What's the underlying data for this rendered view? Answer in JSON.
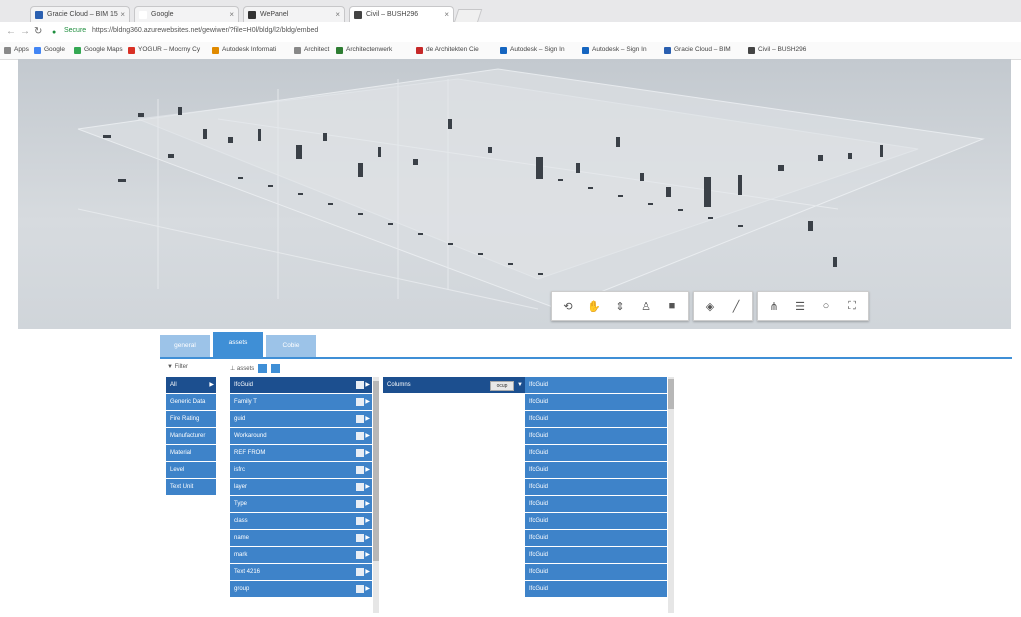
{
  "browser": {
    "tabs": [
      {
        "label": "Gracie Cloud – BIM 15",
        "icon_color": "#2a5fb0",
        "active": false
      },
      {
        "label": "Google",
        "icon_color": "#ffffff",
        "active": false
      },
      {
        "label": "WePanel",
        "icon_color": "#333333",
        "active": false
      },
      {
        "label": "Civil – BUSH296",
        "icon_color": "#444444",
        "active": true
      }
    ],
    "tab_close_glyph": "×",
    "secure_label": "Secure",
    "url": "https://bldng360.azurewebsites.net/gewiwer/?file=H0l/bldg/l2/bldg/embed",
    "bookmarks": [
      {
        "label": "Apps",
        "icon_color": "#888888"
      },
      {
        "label": "Google",
        "icon_color": "#4285f4"
      },
      {
        "label": "Google Maps",
        "icon_color": "#34a853"
      },
      {
        "label": "YOGUR – Mocrny Cy",
        "icon_color": "#d93025"
      },
      {
        "label": "Autodesk Informati",
        "icon_color": "#e08a00"
      },
      {
        "label": "Architect",
        "icon_color": "#888888"
      },
      {
        "label": "Architectenwerk",
        "icon_color": "#2e7d32"
      },
      {
        "label": "de Architekten Cie",
        "icon_color": "#c62828"
      },
      {
        "label": "Autodesk – Sign In",
        "icon_color": "#1565c0"
      },
      {
        "label": "Autodesk – Sign In",
        "icon_color": "#1565c0"
      },
      {
        "label": "Gracie Cloud – BIM",
        "icon_color": "#2a5fb0"
      },
      {
        "label": "Civil – BUSH296",
        "icon_color": "#444444"
      }
    ]
  },
  "viewer": {
    "toolbar": [
      [
        "orbit-icon",
        "pan-icon",
        "zoom-icon",
        "walk-icon",
        "camera-icon"
      ],
      [
        "section-icon",
        "measure-icon"
      ],
      [
        "model-browser-icon",
        "properties-icon",
        "settings-icon",
        "fullscreen-icon"
      ]
    ]
  },
  "panel": {
    "tabs": [
      {
        "label": "general",
        "active": false
      },
      {
        "label": "assets",
        "active": true
      },
      {
        "label": "Cobie",
        "active": false
      }
    ],
    "tools_left": "▼ Filter",
    "tools_right": "⊥ assets",
    "col1": {
      "header": "All",
      "items": [
        "Generic Data",
        "Fire Rating",
        "Manufacturer",
        "Material",
        "Level",
        "Text Unit"
      ]
    },
    "col2": {
      "header": "IfcGuid",
      "items": [
        "Family T",
        "guid",
        "Workaround",
        "REF FROM",
        "isfrc",
        "layer",
        "Type",
        "class",
        "name",
        "mark",
        "Text 4216",
        "group"
      ]
    },
    "col3": {
      "header": "Columns",
      "dropdown": "ocup"
    },
    "col4": {
      "header": "IfcGuid",
      "items": [
        "IfcGuid",
        "IfcGuid",
        "IfcGuid",
        "IfcGuid",
        "IfcGuid",
        "IfcGuid",
        "IfcGuid",
        "IfcGuid",
        "IfcGuid",
        "IfcGuid",
        "IfcGuid",
        "IfcGuid"
      ]
    }
  }
}
